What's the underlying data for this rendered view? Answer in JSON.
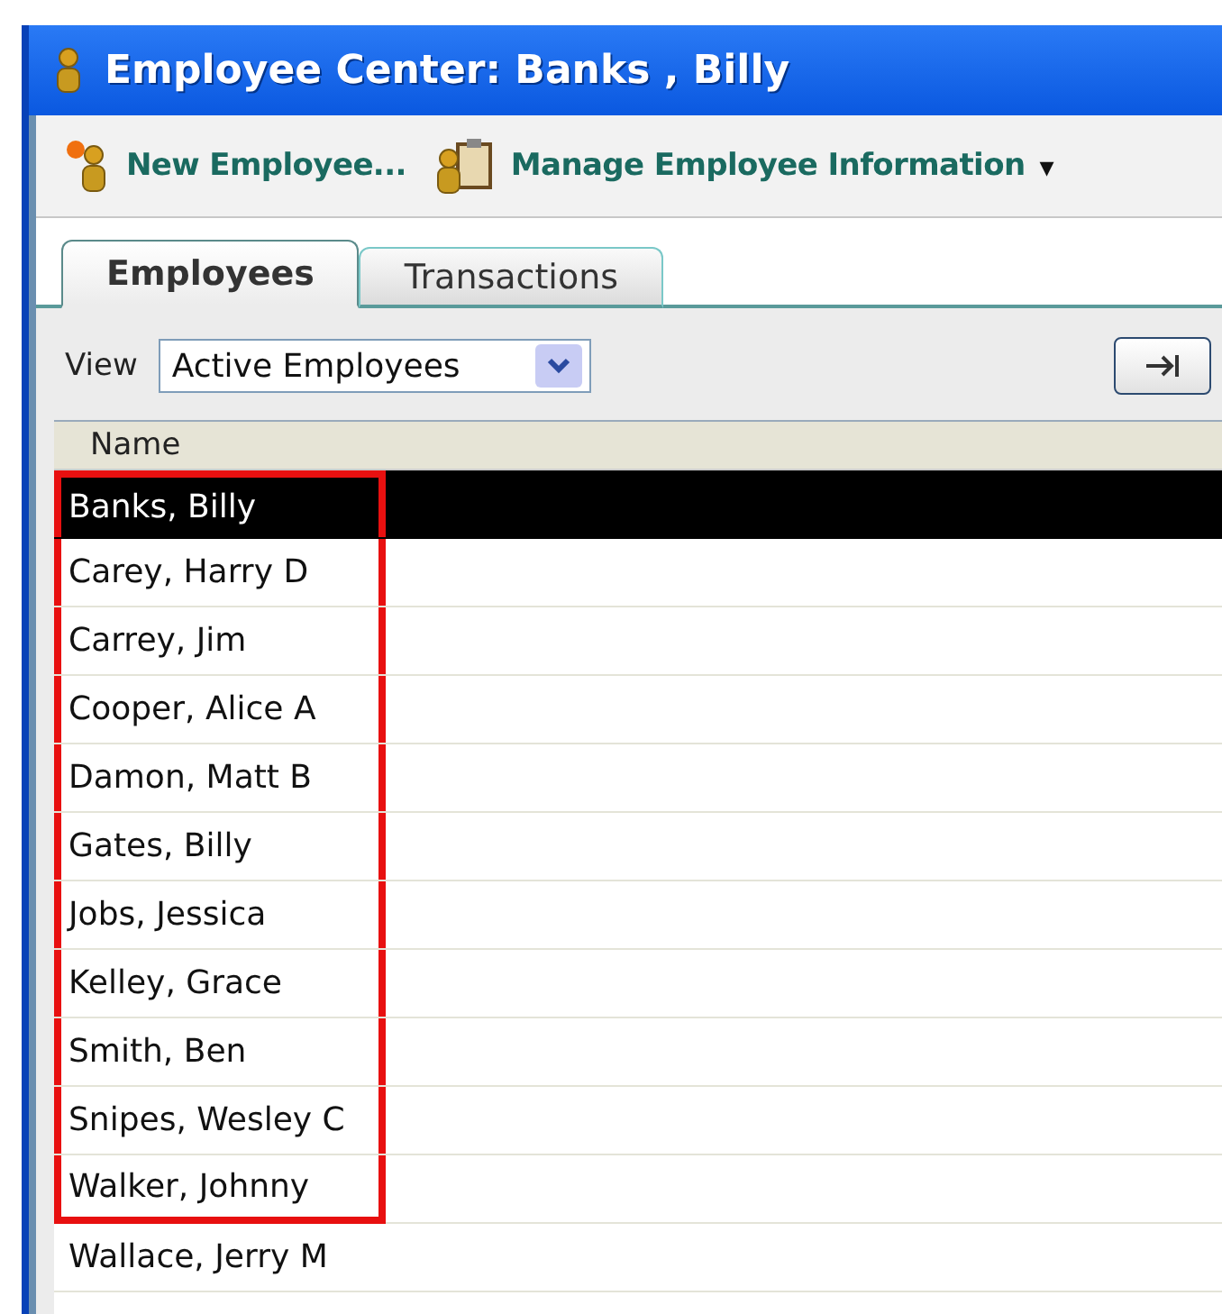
{
  "window": {
    "title": "Employee Center: Banks , Billy"
  },
  "toolbar": [
    {
      "kind": "new",
      "label": "New Employee..."
    },
    {
      "kind": "manage",
      "label": "Manage Employee Information",
      "dropdown": "▾"
    }
  ],
  "tabs": [
    {
      "label": "Employees",
      "selected": true
    },
    {
      "label": "Transactions",
      "selected": false
    }
  ],
  "view": {
    "label": "View",
    "value": "Active Employees"
  },
  "table": {
    "columns": [
      "Name"
    ],
    "rows": [
      {
        "name": "Banks, Billy",
        "selected": true,
        "highlighted": true
      },
      {
        "name": "Carey, Harry D",
        "selected": false,
        "highlighted": true
      },
      {
        "name": "Carrey, Jim",
        "selected": false,
        "highlighted": true
      },
      {
        "name": "Cooper, Alice A",
        "selected": false,
        "highlighted": true
      },
      {
        "name": "Damon, Matt B",
        "selected": false,
        "highlighted": true
      },
      {
        "name": "Gates, Billy",
        "selected": false,
        "highlighted": true
      },
      {
        "name": "Jobs, Jessica",
        "selected": false,
        "highlighted": true
      },
      {
        "name": "Kelley, Grace",
        "selected": false,
        "highlighted": true
      },
      {
        "name": "Smith, Ben",
        "selected": false,
        "highlighted": true
      },
      {
        "name": "Snipes, Wesley C",
        "selected": false,
        "highlighted": true
      },
      {
        "name": "Walker, Johnny",
        "selected": false,
        "highlighted": true
      },
      {
        "name": "Wallace, Jerry M",
        "selected": false,
        "highlighted": false
      }
    ]
  }
}
